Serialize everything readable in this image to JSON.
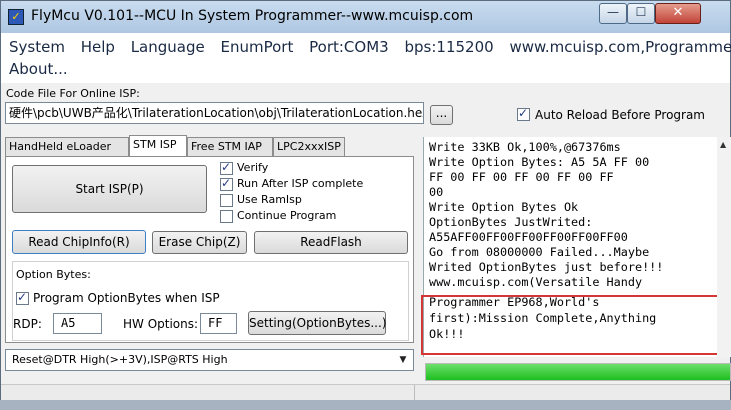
{
  "window": {
    "title": "FlyMcu V0.101--MCU In System Programmer--www.mcuisp.com",
    "app_icon_glyph": "✓",
    "controls": {
      "minimize": "—",
      "maximize": "☐",
      "close": "✕"
    }
  },
  "menu": {
    "row1": [
      "System",
      "Help",
      "Language",
      "EnumPort",
      "Port:COM3",
      "bps:115200",
      "www.mcuisp.com,Programmer"
    ],
    "row2": [
      "About..."
    ]
  },
  "code_file": {
    "label": "Code File For Online ISP:",
    "path": "硬件\\pcb\\UWB产品化\\TrilaterationLocation\\obj\\TrilaterationLocation.hex",
    "browse_label": "...",
    "auto_reload_label": "Auto Reload Before Program",
    "auto_reload_checked": true
  },
  "tabs": [
    "HandHeld eLoader",
    "STM ISP",
    "Free STM IAP",
    "LPC2xxxISP"
  ],
  "active_tab": "STM ISP",
  "isp": {
    "start_button": "Start ISP(P)",
    "options": [
      {
        "label": "Verify",
        "checked": true
      },
      {
        "label": "Run After ISP complete",
        "checked": true
      },
      {
        "label": "Use RamIsp",
        "checked": false
      },
      {
        "label": "Continue Program",
        "checked": false
      }
    ],
    "read_chipinfo_button": "Read ChipInfo(R)",
    "erase_chip_button": "Erase Chip(Z)",
    "read_flash_button": "ReadFlash"
  },
  "option_bytes": {
    "group_label": "Option Bytes:",
    "program_label": "Program OptionBytes when ISP",
    "program_checked": true,
    "rdp_label": "RDP:",
    "rdp_value": "A5",
    "hw_label": "HW Options:",
    "hw_value": "FF",
    "setting_button": "Setting(OptionBytes...)"
  },
  "reset_mode": {
    "selected": "Reset@DTR High(>+3V),ISP@RTS High"
  },
  "log": {
    "lines": [
      "Write 33KB Ok,100%,@67376ms",
      "Write Option Bytes: A5 5A FF 00",
      "FF 00 FF 00 FF 00 FF 00 FF",
      "00",
      "Write Option Bytes Ok",
      "OptionBytes JustWrited:",
      "A55AFF00FF00FF00FF00FF00FF00",
      "Go from 08000000 Failed...Maybe",
      "Writed OptionBytes just before!!!",
      "www.mcuisp.com(Versatile Handy",
      "Programmer EP968,World's",
      "first):Mission Complete,Anything",
      "Ok!!!"
    ]
  },
  "progress": {
    "percent": 100,
    "color": "#22c022"
  }
}
